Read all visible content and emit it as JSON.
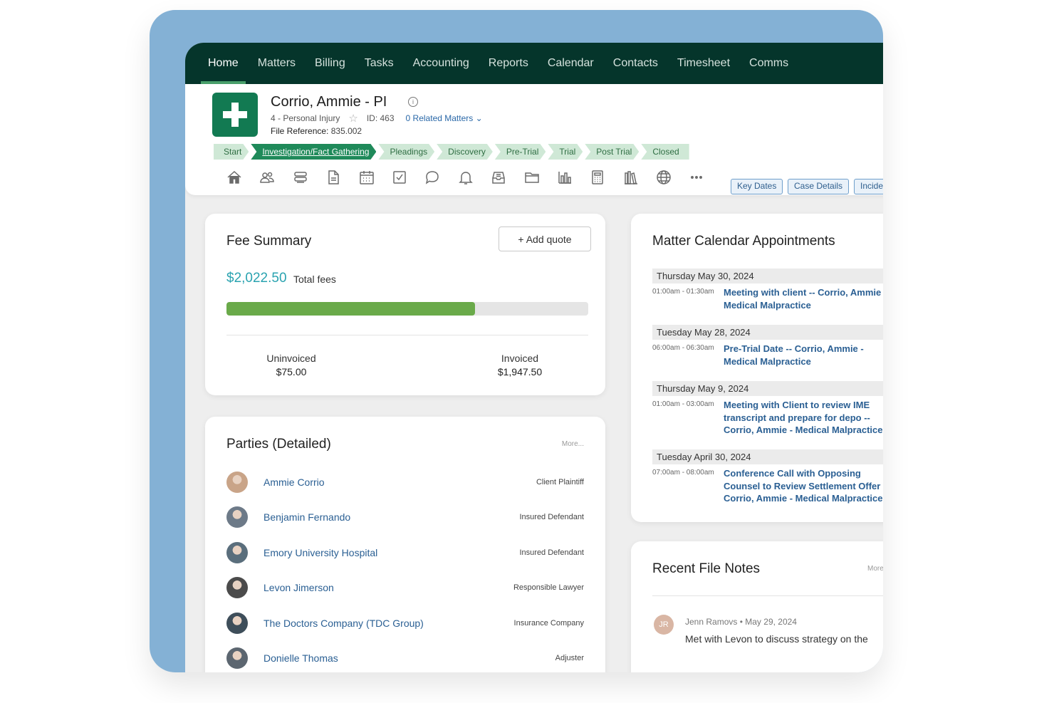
{
  "nav": {
    "items": [
      "Home",
      "Matters",
      "Billing",
      "Tasks",
      "Accounting",
      "Reports",
      "Calendar",
      "Contacts",
      "Timesheet",
      "Comms"
    ],
    "active": "Home"
  },
  "matter": {
    "title": "Corrio, Ammie - PI",
    "type": "4 - Personal Injury",
    "id": "ID: 463",
    "related": "0  Related Matters",
    "file_ref_label": "File Reference:",
    "file_ref_value": "835.002"
  },
  "stages": [
    "Start",
    "Investigation/Fact Gathering",
    "Pleadings",
    "Discovery",
    "Pre-Trial",
    "Trial",
    "Post Trial",
    "Closed"
  ],
  "current_stage": "Investigation/Fact Gathering",
  "toolbar": {
    "icons": [
      "home-icon",
      "people-icon",
      "layers-icon",
      "document-icon",
      "calendar-icon",
      "checkbox-icon",
      "chat-icon",
      "bell-icon",
      "inbox-icon",
      "folder-icon",
      "bar-chart-icon",
      "calculator-icon",
      "library-icon",
      "globe-icon",
      "more-icon"
    ],
    "tabs": [
      "Key Dates",
      "Case Details",
      "Incide"
    ]
  },
  "fee_summary": {
    "title": "Fee Summary",
    "add_quote": "+ Add quote",
    "total": "$2,022.50",
    "total_label": "Total fees",
    "invoiced_fraction": 0.6866,
    "uninvoiced_label": "Uninvoiced",
    "uninvoiced_value": "$75.00",
    "invoiced_label": "Invoiced",
    "invoiced_value": "$1,947.50",
    "colors": {
      "amount": "#2aa3b0",
      "bar": "#6aaa4a"
    }
  },
  "parties": {
    "title": "Parties (Detailed)",
    "more": "More...",
    "rows": [
      {
        "name": "Ammie Corrio",
        "role": "Client Plaintiff"
      },
      {
        "name": "Benjamin Fernando",
        "role": "Insured Defendant"
      },
      {
        "name": "Emory University Hospital",
        "role": "Insured Defendant"
      },
      {
        "name": "Levon Jimerson",
        "role": "Responsible Lawyer"
      },
      {
        "name": "The Doctors Company (TDC Group)",
        "role": "Insurance Company"
      },
      {
        "name": "Donielle Thomas",
        "role": "Adjuster"
      }
    ]
  },
  "calendar": {
    "title": "Matter Calendar Appointments",
    "days": [
      {
        "date": "Thursday May 30, 2024",
        "time": "01:00am - 01:30am",
        "lines": [
          "Meeting with client -- Corrio, Ammie -",
          "Medical Malpractice"
        ]
      },
      {
        "date": "Tuesday May 28, 2024",
        "time": "06:00am - 06:30am",
        "lines": [
          "Pre-Trial Date -- Corrio, Ammie -",
          "Medical Malpractice"
        ]
      },
      {
        "date": "Thursday May 9, 2024",
        "time": "01:00am - 03:00am",
        "lines": [
          "Meeting with Client to review IME",
          "transcript and prepare for depo --",
          "Corrio, Ammie - Medical Malpractice"
        ]
      },
      {
        "date": "Tuesday April 30, 2024",
        "time": "07:00am - 08:00am",
        "lines": [
          "Conference Call with Opposing",
          "Counsel to Review Settlement Offer -",
          "Corrio, Ammie - Medical Malpractice"
        ]
      }
    ]
  },
  "notes": {
    "title": "Recent File Notes",
    "more": "More",
    "initials": "JR",
    "author": "Jenn Ramovs",
    "separator": "•",
    "date": "May 29, 2024",
    "text": "Met with Levon to discuss strategy on the"
  }
}
